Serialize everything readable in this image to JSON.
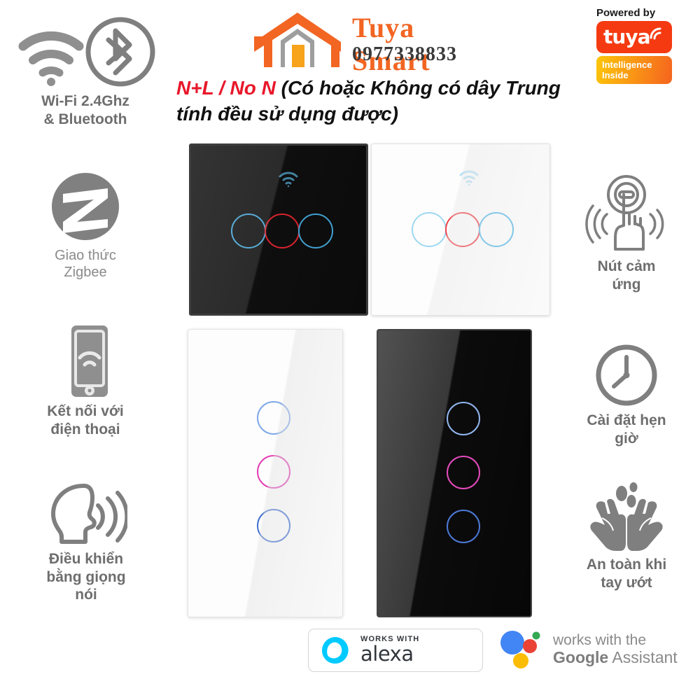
{
  "brand": {
    "logo_name": "Tuya Smart",
    "phone": "0977338833",
    "logo_icon": "house-icon"
  },
  "tuya_badge": {
    "powered_by": "Powered by",
    "wordmark": "tuya",
    "intelligence": "Intelligence",
    "inside": "Inside",
    "color_block": "#f53a11",
    "color_gradient_start": "#fcc60a",
    "color_gradient_end": "#f5641e"
  },
  "headline": {
    "red_part": "N+L / No N",
    "black_part": " (Có hoặc Không có dây Trung tính đều sử dụng được)",
    "red_color": "#e8172a"
  },
  "left_features": [
    {
      "icon": "wifi-bluetooth-icon",
      "label": "Wi-Fi 2.4Ghz\n& Bluetooth"
    },
    {
      "icon": "zigbee-icon",
      "label": "Giao thức\nZigbee"
    },
    {
      "icon": "phone-connect-icon",
      "label": "Kết nối với\nđiện thoại"
    },
    {
      "icon": "voice-control-icon",
      "label": "Điều khiển\nbằng giọng\nnói"
    }
  ],
  "right_features": [
    {
      "icon": "touch-button-icon",
      "label": "Nút cảm\nứng"
    },
    {
      "icon": "clock-icon",
      "label": "Cài đặt hẹn\ngiờ"
    },
    {
      "icon": "wet-hands-icon",
      "label": "An toàn khi\ntay ướt"
    }
  ],
  "panels": [
    {
      "name": "eu-black-3gang",
      "style": "EU",
      "finish": "black",
      "gangs": 3,
      "wifi_indicator": true,
      "ring_colors": [
        "#3f9fd0",
        "#d8202a",
        "#3f9fd0"
      ]
    },
    {
      "name": "eu-white-3gang",
      "style": "EU",
      "finish": "white",
      "gangs": 3,
      "wifi_indicator": true,
      "ring_colors": [
        "#9ed8f2",
        "#f0434b",
        "#5bbbe8"
      ]
    },
    {
      "name": "us-white-3gang",
      "style": "US",
      "finish": "white",
      "gangs": 3,
      "wifi_indicator": false,
      "ring_colors": [
        "#7fa8e8",
        "#e23fb4",
        "#3f6fd0"
      ]
    },
    {
      "name": "us-black-3gang",
      "style": "US",
      "finish": "black",
      "gangs": 3,
      "wifi_indicator": false,
      "ring_colors": [
        "#8fb4ee",
        "#e348bb",
        "#4a78d8"
      ]
    }
  ],
  "bottom_badges": {
    "alexa": {
      "works_with": "WORKS WITH",
      "name": "alexa",
      "logo_color": "#00caff"
    },
    "google": {
      "line1": "works with the",
      "line2_bold": "Google",
      "line2_rest": " Assistant",
      "dot_blue": "#4285f4",
      "dot_red": "#ea4335",
      "dot_yellow": "#fbbc05",
      "dot_green": "#34a853"
    }
  }
}
